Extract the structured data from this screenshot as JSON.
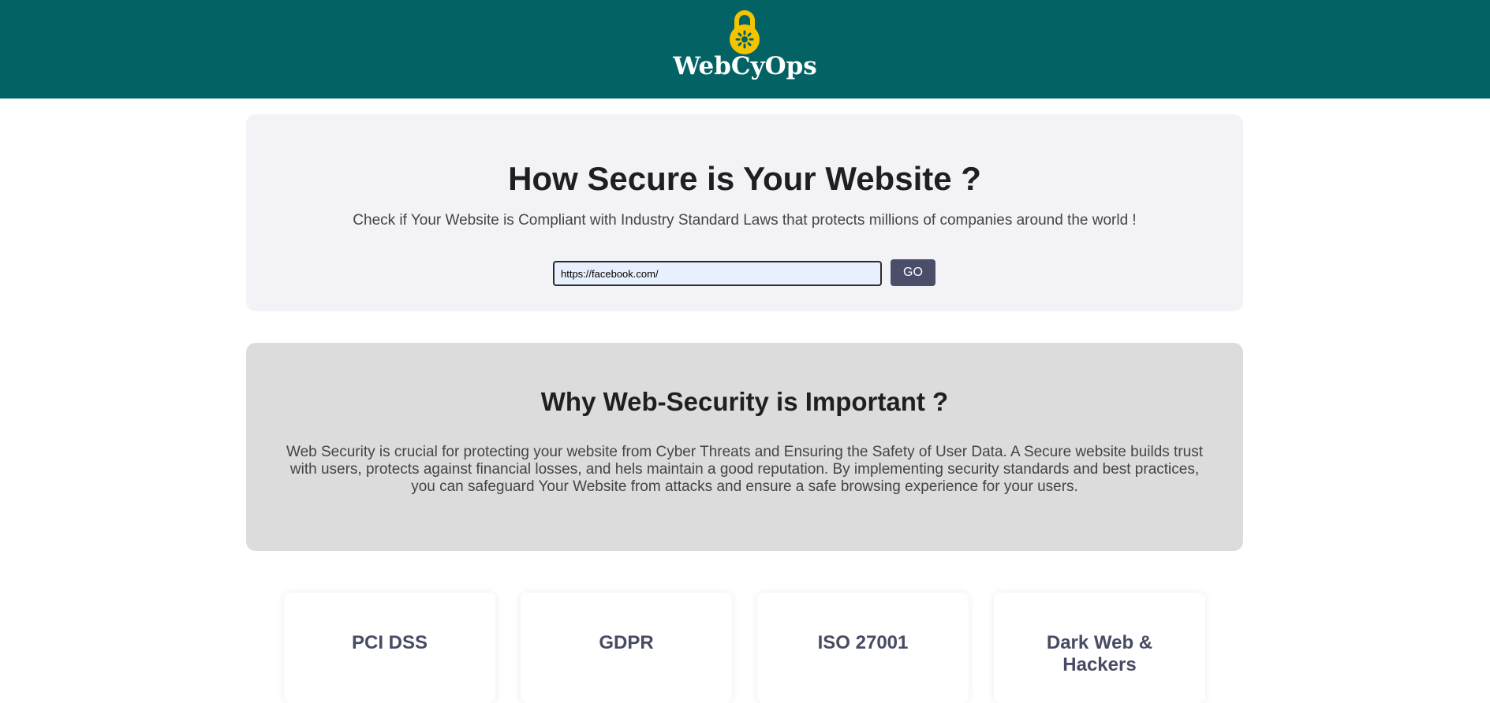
{
  "header": {
    "brand": "WebCyOps",
    "logo_icon": "padlock-icon",
    "background_color": "#026264",
    "logo_color": "#f5c400"
  },
  "hero": {
    "title": "How Secure is Your Website ?",
    "subtitle": "Check if Your Website is Compliant with Industry Standard Laws that protects millions of companies around the world !",
    "url_value": "https://facebook.com/",
    "go_label": "GO"
  },
  "why": {
    "title": "Why Web-Security is Important ?",
    "body": "Web Security is crucial for protecting your website from Cyber Threats and Ensuring the Safety of User Data. A Secure website builds trust with users, protects against financial losses, and hels maintain a good reputation. By implementing security standards and best practices, you can safeguard Your Website from attacks and ensure a safe browsing experience for your users."
  },
  "cards": [
    {
      "title": "PCI DSS"
    },
    {
      "title": "GDPR"
    },
    {
      "title": "ISO 27001"
    },
    {
      "title": "Dark Web & Hackers"
    }
  ]
}
